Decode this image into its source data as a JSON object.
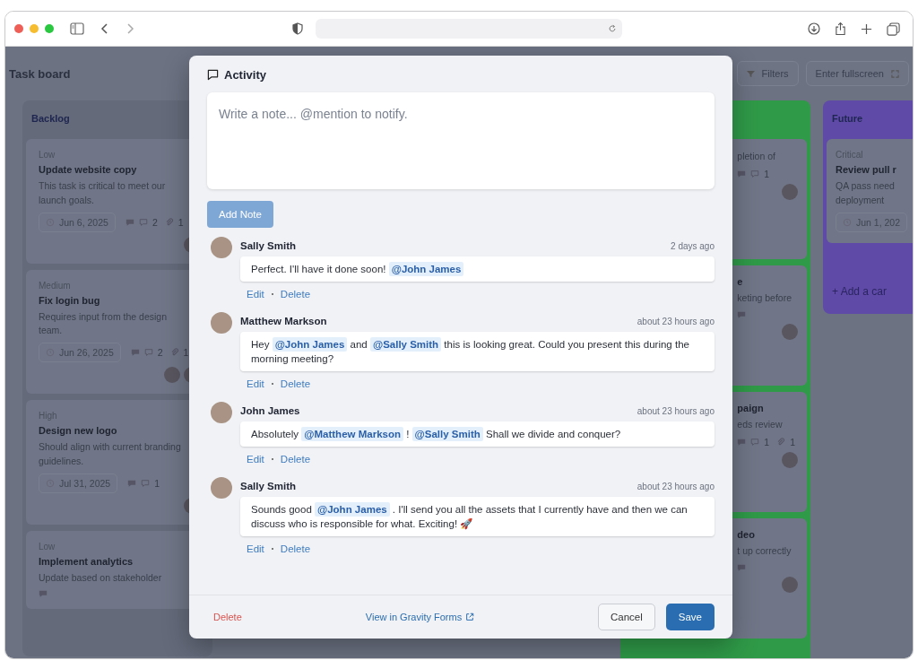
{
  "board": {
    "title": "Task board",
    "buttons": [
      {
        "kind": "filter",
        "label": "Filters"
      },
      {
        "kind": "fullscreen",
        "label": "Enter fullscreen"
      }
    ],
    "columns": [
      {
        "kind": "full",
        "title": "Backlog",
        "color": "#646a7a",
        "cards": [
          {
            "priority": "Low",
            "title": "Update website copy",
            "description": "This task is critical to meet our launch goals.",
            "date": "Jun 6, 2025",
            "comments": "2",
            "attachments": "1",
            "assignees": [
              {
                "kind": "photo"
              }
            ]
          },
          {
            "priority": "Medium",
            "title": "Fix login bug",
            "description": "Requires input from the design team.",
            "date": "Jun 26, 2025",
            "comments": "2",
            "attachments": "1",
            "assignees": [
              {
                "kind": "photo"
              },
              {
                "kind": "photo"
              }
            ]
          },
          {
            "priority": "High",
            "title": "Design new logo",
            "description": "Should align with current branding guidelines.",
            "date": "Jul 31, 2025",
            "comments": "1",
            "assignees": [
              {
                "kind": "photo"
              }
            ]
          },
          {
            "priority": "Low",
            "title": "Implement analytics",
            "description": "Update based on stakeholder"
          }
        ]
      },
      {
        "kind": "partial",
        "color": "#2f9a48",
        "cards": [
          {
            "description": "pletion of",
            "comments": "1",
            "assignees": [
              {
                "kind": "photo"
              }
            ]
          },
          {
            "title": "e",
            "description": "keting before",
            "assignees": [
              {
                "kind": "photo"
              }
            ]
          },
          {
            "title": "paign",
            "description": "eds review",
            "comments": "1",
            "attachments": "1",
            "assignees": [
              {
                "kind": "photo"
              }
            ]
          },
          {
            "title": "deo",
            "description": "t up correctly",
            "assignees": [
              {
                "kind": "photo"
              }
            ]
          }
        ]
      },
      {
        "kind": "edge",
        "title": "Future",
        "color": "#5f4aa8",
        "cards": [
          {
            "priority": "Critical",
            "title": "Review pull r",
            "description": "QA pass need deployment",
            "date": "Jun 1, 202"
          }
        ],
        "add_label": "+ Add a car"
      }
    ]
  },
  "modal": {
    "title": "Activity",
    "note_field": {
      "placeholder": "Write a note... @mention to notify."
    },
    "add_button": {
      "label": "Add Note",
      "disabled": true
    },
    "comments": [
      {
        "author": "Sally Smith",
        "time": "2 days ago",
        "parts": [
          {
            "kind": "text",
            "text": "Perfect. I'll have it done soon! "
          },
          {
            "kind": "mention",
            "text": "@John James"
          }
        ],
        "actions": [
          "Edit",
          "Delete"
        ]
      },
      {
        "author": "Matthew Markson",
        "time": "about 23 hours ago",
        "parts": [
          {
            "kind": "text",
            "text": "Hey "
          },
          {
            "kind": "mention",
            "text": "@John James"
          },
          {
            "kind": "text",
            "text": " and "
          },
          {
            "kind": "mention",
            "text": "@Sally Smith"
          },
          {
            "kind": "text",
            "text": " this is looking great. Could you present this during the morning meeting?"
          }
        ],
        "actions": [
          "Edit",
          "Delete"
        ]
      },
      {
        "author": "John James",
        "time": "about 23 hours ago",
        "parts": [
          {
            "kind": "text",
            "text": "Absolutely "
          },
          {
            "kind": "mention",
            "text": "@Matthew Markson"
          },
          {
            "kind": "text",
            "text": " ! "
          },
          {
            "kind": "mention",
            "text": "@Sally Smith"
          },
          {
            "kind": "text",
            "text": " Shall we divide and conquer?"
          }
        ],
        "actions": [
          "Edit",
          "Delete"
        ]
      },
      {
        "author": "Sally Smith",
        "time": "about 23 hours ago",
        "parts": [
          {
            "kind": "text",
            "text": "Sounds good "
          },
          {
            "kind": "mention",
            "text": "@John James"
          },
          {
            "kind": "text",
            "text": " . I'll send you all the assets that I currently have and then we can discuss who is responsible for what. Exciting! 🚀"
          }
        ],
        "actions": [
          "Edit",
          "Delete"
        ]
      }
    ],
    "footer": {
      "delete_label": "Delete",
      "link_label": "View in Gravity Forms",
      "cancel_label": "Cancel",
      "save_label": "Save"
    }
  }
}
